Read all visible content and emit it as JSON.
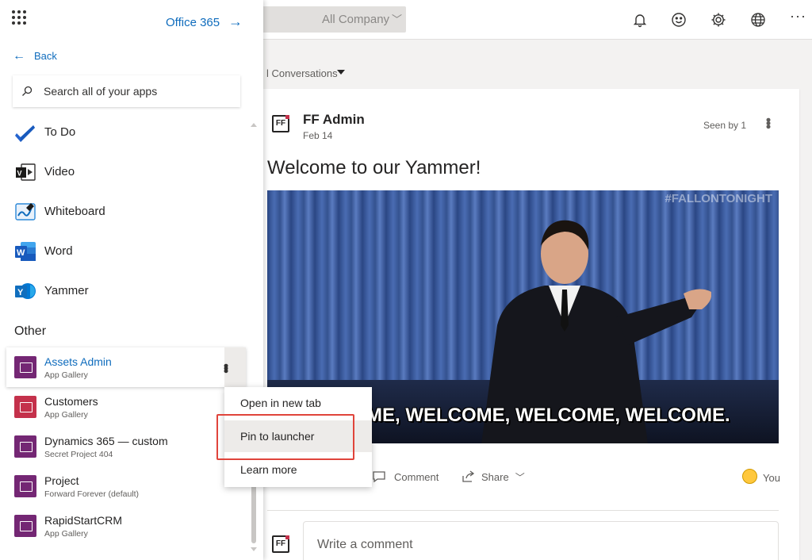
{
  "topbar": {
    "scope_label": "All Company",
    "icons": [
      "bell-icon",
      "smiley-icon",
      "gear-icon",
      "globe-icon",
      "more-icon"
    ],
    "more_label": "···"
  },
  "feed": {
    "filter_label": "l Conversations"
  },
  "post": {
    "avatar_text": "FF",
    "author": "FF Admin",
    "date": "Feb 14",
    "seen_by": "Seen by 1",
    "title": "Welcome to our Yammer!",
    "gif_tag": "#FALLONTONIGHT",
    "gif_caption": "ME, WELCOME, WELCOME, WELCOME.",
    "actions": {
      "comment": "Comment",
      "share": "Share"
    },
    "reaction_user": "You",
    "comment_placeholder": "Write a comment"
  },
  "launcher": {
    "title": "Office 365",
    "back_label": "Back",
    "search_placeholder": "Search all of your apps",
    "apps": [
      {
        "name": "To Do",
        "icon": "todo-icon"
      },
      {
        "name": "Video",
        "icon": "video-icon"
      },
      {
        "name": "Whiteboard",
        "icon": "whiteboard-icon"
      },
      {
        "name": "Word",
        "icon": "word-icon"
      },
      {
        "name": "Yammer",
        "icon": "yammer-icon"
      }
    ],
    "other_heading": "Other",
    "other_apps": [
      {
        "name": "Assets Admin",
        "sub": "App Gallery"
      },
      {
        "name": "Customers",
        "sub": "App Gallery"
      },
      {
        "name": "Dynamics 365 — custom",
        "sub": "Secret Project 404"
      },
      {
        "name": "Project",
        "sub": "Forward Forever (default)"
      },
      {
        "name": "RapidStartCRM",
        "sub": "App Gallery"
      }
    ]
  },
  "context_menu": {
    "items": [
      "Open in new tab",
      "Pin to launcher",
      "Learn more"
    ],
    "highlighted": "Pin to launcher"
  },
  "colors": {
    "accent": "#0f6cbd",
    "gallery_app": "#742774",
    "highlight_box": "#e0443b"
  }
}
